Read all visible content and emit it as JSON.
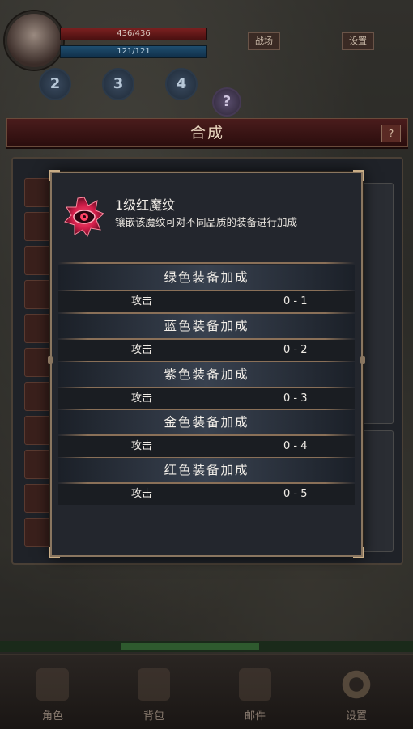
{
  "hud": {
    "hp_text": "436/436",
    "mp_text": "121/121",
    "btn_a": "战场",
    "btn_b": "设置",
    "skills": [
      "2",
      "3",
      "4"
    ],
    "help": "?"
  },
  "synthesis": {
    "title": "合成",
    "close": "?"
  },
  "tooltip": {
    "item_name": "1级红魔纹",
    "item_desc": "镶嵌该魔纹可对不同品质的装备进行加成",
    "sections": [
      {
        "header": "绿色装备加成",
        "stat": "攻击",
        "value": "0 - 1"
      },
      {
        "header": "蓝色装备加成",
        "stat": "攻击",
        "value": "0 - 2"
      },
      {
        "header": "紫色装备加成",
        "stat": "攻击",
        "value": "0 - 3"
      },
      {
        "header": "金色装备加成",
        "stat": "攻击",
        "value": "0 - 4"
      },
      {
        "header": "红色装备加成",
        "stat": "攻击",
        "value": "0 - 5"
      }
    ]
  },
  "nav": {
    "items": [
      {
        "label": "角色",
        "icon": "character-icon"
      },
      {
        "label": "背包",
        "icon": "bag-icon"
      },
      {
        "label": "邮件",
        "icon": "mail-icon"
      },
      {
        "label": "设置",
        "icon": "gear-icon"
      }
    ]
  },
  "colors": {
    "popup_bg": "#23262d",
    "border_gold": "#8a7660",
    "item_accent": "#e0345a"
  }
}
